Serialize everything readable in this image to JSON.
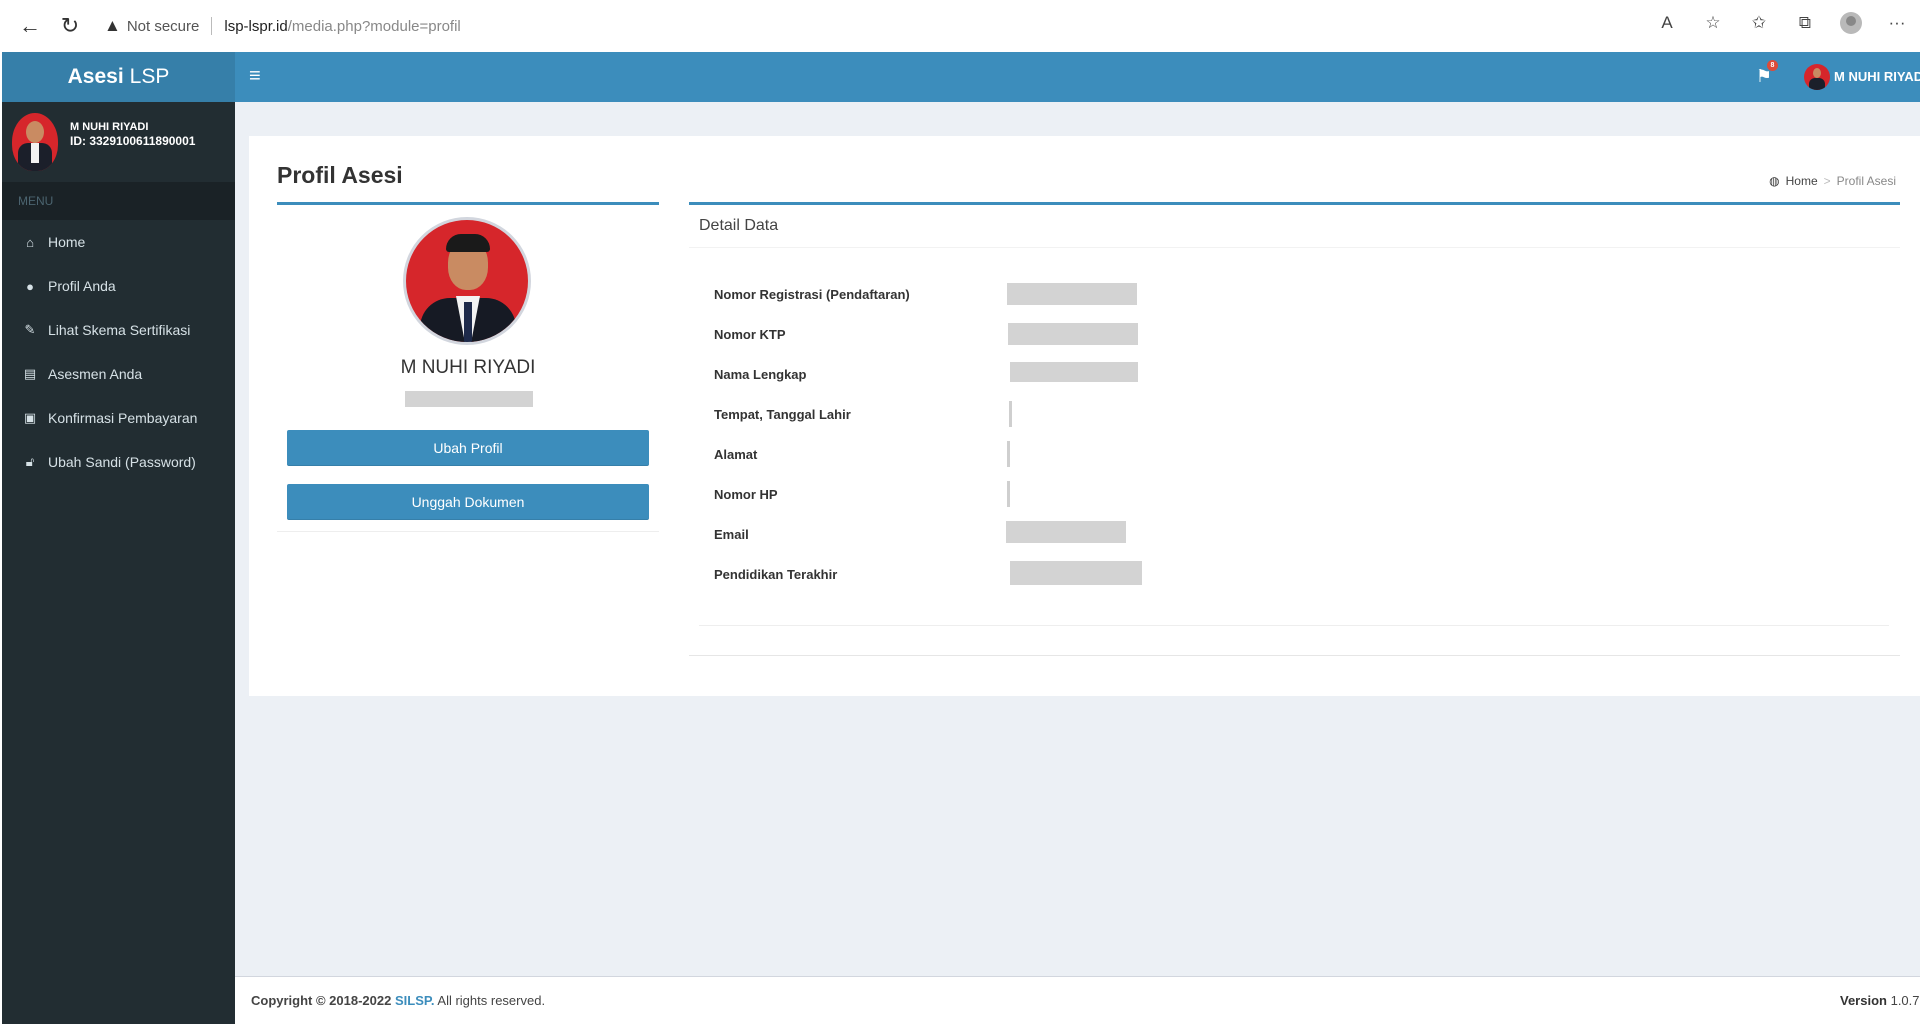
{
  "browser": {
    "security_label": "Not secure",
    "url_host": "lsp-lspr.id",
    "url_path": "/media.php?module=profil"
  },
  "app": {
    "logo_bold": "Asesi",
    "logo_rest": "LSP",
    "user_name": "M NUHI RIYADI",
    "user_id": "ID: 3329100611890001",
    "notification_count": "8"
  },
  "sidebar": {
    "menu_header": "MENU",
    "items": [
      {
        "label": "Home",
        "icon": "home-icon"
      },
      {
        "label": "Profil Anda",
        "icon": "user-icon"
      },
      {
        "label": "Lihat Skema Sertifikasi",
        "icon": "edit-icon"
      },
      {
        "label": "Asesmen Anda",
        "icon": "file-icon"
      },
      {
        "label": "Konfirmasi Pembayaran",
        "icon": "money-icon"
      },
      {
        "label": "Ubah Sandi (Password)",
        "icon": "unlock-icon"
      }
    ]
  },
  "page": {
    "title": "Profil Asesi",
    "breadcrumb_home": "Home",
    "breadcrumb_current": "Profil Asesi"
  },
  "profile": {
    "name": "M NUHI RIYADI",
    "edit_button": "Ubah Profil",
    "upload_button": "Unggah Dokumen"
  },
  "detail": {
    "title": "Detail Data",
    "fields": [
      {
        "label": "Nomor Registrasi (Pendaftaran)"
      },
      {
        "label": "Nomor KTP"
      },
      {
        "label": "Nama Lengkap"
      },
      {
        "label": "Tempat, Tanggal Lahir"
      },
      {
        "label": "Alamat"
      },
      {
        "label": "Nomor HP"
      },
      {
        "label": "Email"
      },
      {
        "label": "Pendidikan Terakhir"
      }
    ]
  },
  "footer": {
    "copyright": "Copyright © 2018-2022",
    "brand": "SILSP.",
    "rights": "All rights reserved.",
    "version_label": "Version",
    "version_number": "1.0.7"
  },
  "colors": {
    "primary": "#3c8dbc",
    "logo_bg": "#367fa9",
    "sidebar_bg": "#222d32",
    "content_bg": "#ecf0f5"
  }
}
